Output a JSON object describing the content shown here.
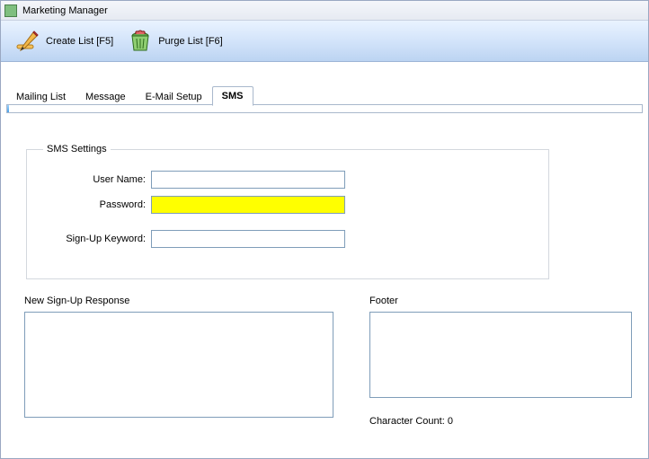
{
  "window": {
    "title": "Marketing Manager"
  },
  "toolbar": {
    "create_list_label": "Create List [F5]",
    "purge_list_label": "Purge List [F6]"
  },
  "tabs": {
    "mailing_list": "Mailing List",
    "message": "Message",
    "email_setup": "E-Mail Setup",
    "sms": "SMS"
  },
  "sms_settings": {
    "legend": "SMS Settings",
    "user_name_label": "User Name:",
    "user_name_value": "",
    "password_label": "Password:",
    "password_value": "",
    "signup_keyword_label": "Sign-Up Keyword:",
    "signup_keyword_value": ""
  },
  "response": {
    "label": "New Sign-Up Response",
    "value": ""
  },
  "footer": {
    "label": "Footer",
    "value": "",
    "char_count_label": "Character Count: 0"
  }
}
